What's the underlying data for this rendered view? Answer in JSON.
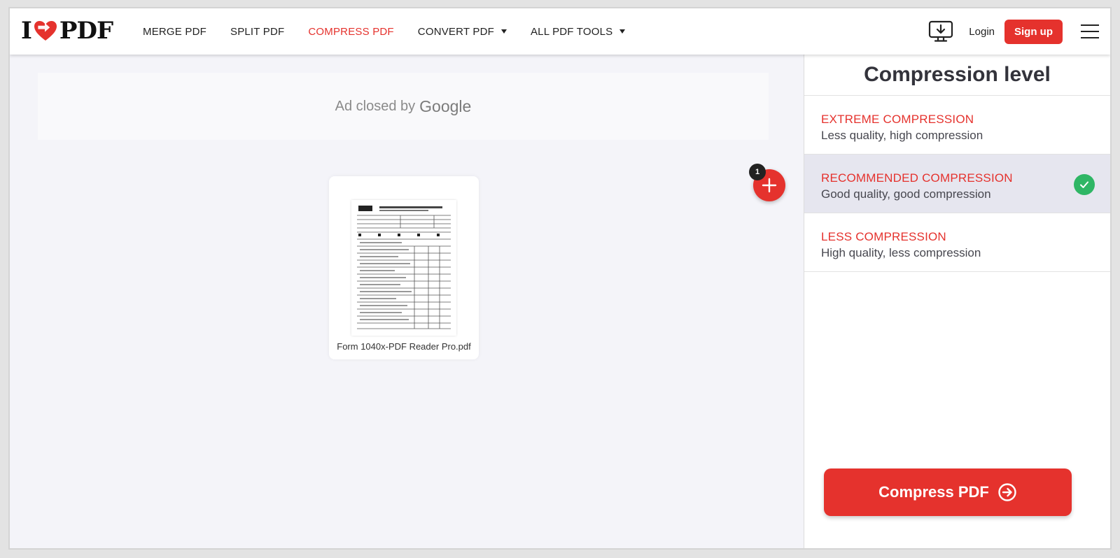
{
  "header": {
    "logo": {
      "left": "I",
      "right": "PDF"
    },
    "nav": [
      {
        "label": "MERGE PDF",
        "active": false,
        "dropdown": false
      },
      {
        "label": "SPLIT PDF",
        "active": false,
        "dropdown": false
      },
      {
        "label": "COMPRESS PDF",
        "active": true,
        "dropdown": false
      },
      {
        "label": "CONVERT PDF",
        "active": false,
        "dropdown": true
      },
      {
        "label": "ALL PDF TOOLS",
        "active": false,
        "dropdown": true
      }
    ],
    "login_label": "Login",
    "signup_label": "Sign up"
  },
  "ad": {
    "text": "Ad closed by",
    "brand": "Google"
  },
  "file": {
    "name": "Form 1040x-PDF Reader Pro.pdf",
    "count_badge": "1"
  },
  "sidebar": {
    "title": "Compression level",
    "options": [
      {
        "title": "EXTREME COMPRESSION",
        "desc": "Less quality, high compression",
        "selected": false
      },
      {
        "title": "RECOMMENDED COMPRESSION",
        "desc": "Good quality, good compression",
        "selected": true
      },
      {
        "title": "LESS COMPRESSION",
        "desc": "High quality, less compression",
        "selected": false
      }
    ],
    "action_label": "Compress PDF"
  },
  "colors": {
    "brand_red": "#e5322d",
    "check_green": "#2fb665",
    "workspace_bg": "#f4f4f9"
  }
}
